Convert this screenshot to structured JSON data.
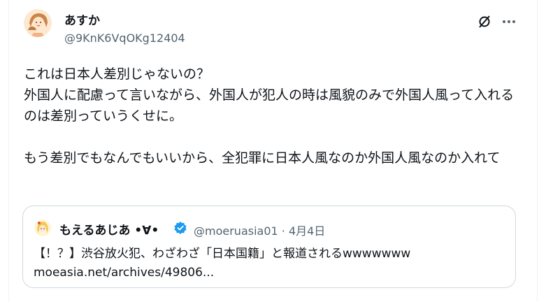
{
  "author": {
    "display_name": "あすか",
    "handle": "@9KnK6VqOKg12404",
    "avatar_icon": "illustrated-mother-and-child-avatar"
  },
  "actions": {
    "grok_icon": "grok-icon",
    "more_icon": "more-horizontal-icon"
  },
  "post_text": "これは日本人差別じゃないの？\n外国人に配慮って言いながら、外国人が犯人の時は風貌のみで外国人風って入れるのは差別っていうくせに。\n\nもう差別でもなんでもいいから、全犯罪に日本人風なのか外国人風なのか入れて",
  "quoted_post": {
    "display_name": "もえるあじあ •∀•",
    "verified_icon": "verified-badge-icon",
    "handle_date": "@moeruasia01 · 4月4日",
    "text": "【！？】渋谷放火犯、わざわざ「日本国籍」と報道されるwwwwwww\nmoeasia.net/archives/49806..."
  },
  "colors": {
    "text_primary": "#0f1419",
    "text_secondary": "#536471",
    "border": "#cfd9de",
    "verified_blue": "#1d9bf0"
  }
}
